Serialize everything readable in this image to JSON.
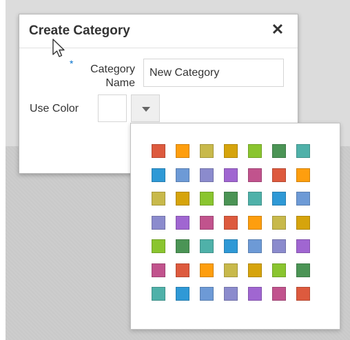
{
  "dialog": {
    "title": "Create Category",
    "close_label": "✕",
    "category_name": {
      "required_marker": "*",
      "label": "Category Name",
      "value": "New Category"
    },
    "use_color": {
      "label": "Use Color",
      "selected_color": "#ffffff"
    }
  },
  "palette": {
    "rows": [
      [
        "#dd5a3e",
        "#fe9e0e",
        "#c8b94b",
        "#d6a40c",
        "#8ac52f",
        "#4b9455",
        "#4fb1a9"
      ],
      [
        "#2f99d6",
        "#6d9ad6",
        "#8b8bcd",
        "#a066d1",
        "#c1538d",
        "#dd5a3e",
        "#fe9e0e"
      ],
      [
        "#c8b94b",
        "#d6a40c",
        "#8ac52f",
        "#4b9455",
        "#4fb1a9",
        "#2f99d6",
        "#6d9ad6"
      ],
      [
        "#8b8bcd",
        "#a066d1",
        "#c1538d",
        "#dd5a3e",
        "#fe9e0e",
        "#c8b94b",
        "#d6a40c"
      ],
      [
        "#8ac52f",
        "#4b9455",
        "#4fb1a9",
        "#2f99d6",
        "#6d9ad6",
        "#8b8bcd",
        "#a066d1"
      ],
      [
        "#c1538d",
        "#dd5a3e",
        "#fe9e0e",
        "#c8b94b",
        "#d6a40c",
        "#8ac52f",
        "#4b9455"
      ],
      [
        "#4fb1a9",
        "#2f99d6",
        "#6d9ad6",
        "#8b8bcd",
        "#a066d1",
        "#c1538d",
        "#dd5a3e"
      ]
    ]
  }
}
